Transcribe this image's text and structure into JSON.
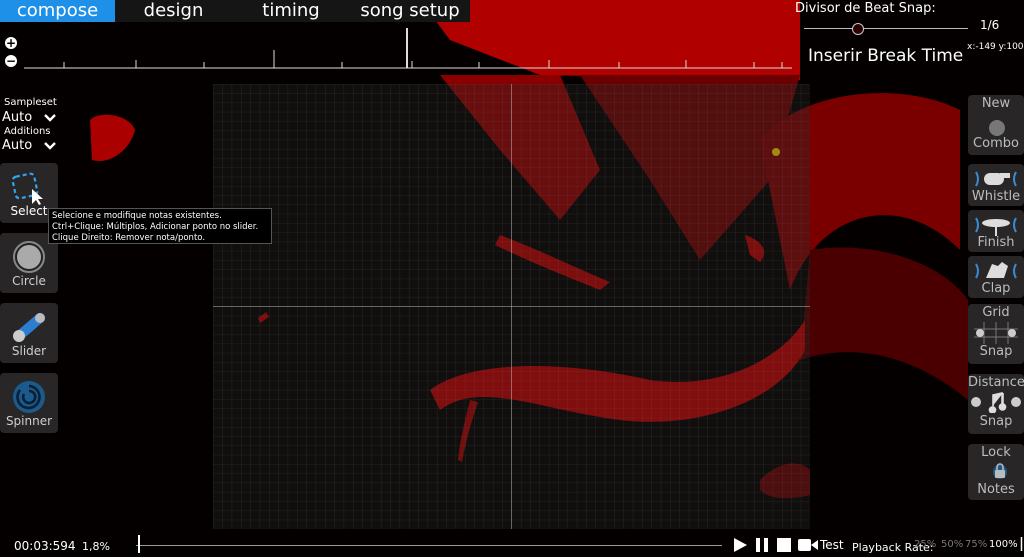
{
  "tabs": [
    {
      "label": "compose",
      "active": true
    },
    {
      "label": "design",
      "active": false
    },
    {
      "label": "timing",
      "active": false
    },
    {
      "label": "song setup",
      "active": false
    }
  ],
  "beat_snap": {
    "label": "Divisor de Beat Snap:",
    "value": "1/6"
  },
  "coords": "x:-149 y:100",
  "break_time": "Inserir Break Time",
  "sampleset": {
    "label": "Sampleset",
    "value": "Auto"
  },
  "additions": {
    "label": "Additions",
    "value": "Auto"
  },
  "tools": [
    {
      "label": "Select",
      "icon": "select-icon",
      "active": true
    },
    {
      "label": "Circle",
      "icon": "circle-icon"
    },
    {
      "label": "Slider",
      "icon": "slider-icon"
    },
    {
      "label": "Spinner",
      "icon": "spinner-icon"
    }
  ],
  "tooltip": {
    "lines": [
      "Selecione e modifique notas existentes.",
      "Ctrl+Clique: Múltiplos, Adicionar ponto no slider.",
      "Clique Direito: Remover nota/ponto."
    ]
  },
  "right_panel": {
    "new_combo": {
      "top": "New",
      "bottom": "Combo"
    },
    "whistle": "Whistle",
    "finish": "Finish",
    "clap": "Clap",
    "grid_snap": {
      "top": "Grid",
      "bottom": "Snap"
    },
    "distance_snap": {
      "top": "Distance",
      "bottom": "Snap"
    },
    "lock_notes": {
      "top": "Lock",
      "bottom": "Notes"
    }
  },
  "bottom": {
    "time": "00:03:594",
    "percent": "1,8%",
    "test_label": "Test",
    "playback_rate_label": "Playback Rate:",
    "rates": [
      "25%",
      "50%",
      "75%",
      "100%"
    ],
    "active_rate": "100%"
  },
  "colors": {
    "accent": "#1e90e8",
    "background_red": "#c00000"
  }
}
